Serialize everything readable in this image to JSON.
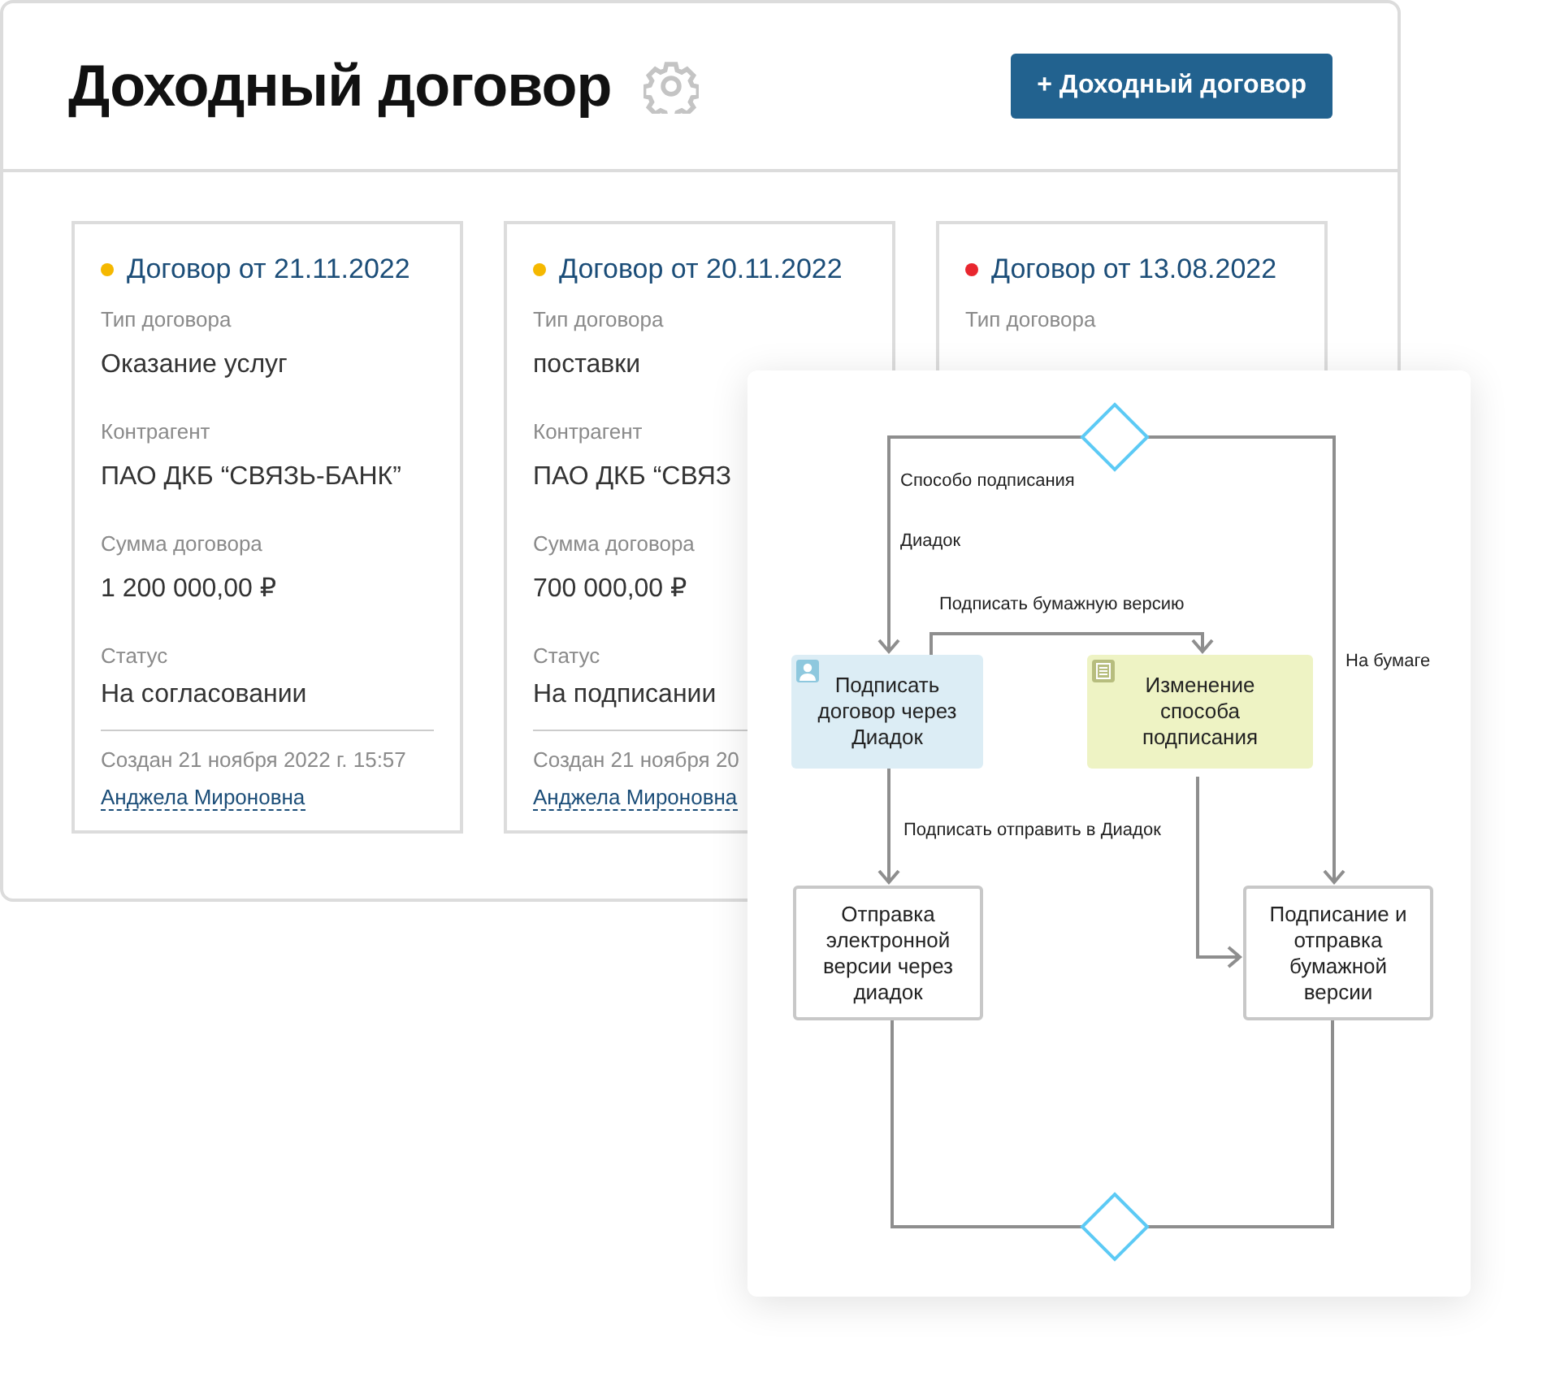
{
  "header": {
    "title": "Доходный договор",
    "add_button": "+ Доходный договор"
  },
  "contracts": [
    {
      "title": "Договор от 21.11.2022",
      "color": "#f5b800",
      "fields": [
        {
          "label": "Тип договора",
          "value": "Оказание услуг"
        },
        {
          "label": "Контрагент",
          "value": "ПАО ДКБ “СВЯЗЬ-БАНК”"
        },
        {
          "label": "Сумма договора",
          "value": "1 200 000,00 ₽"
        },
        {
          "label": "Статус",
          "value": "На согласовании"
        }
      ],
      "created": "Создан 21 ноября 2022 г. 15:57",
      "author": "Анджела Мироновна"
    },
    {
      "title": "Договор от 20.11.2022",
      "color": "#f5b800",
      "fields": [
        {
          "label": "Тип договора",
          "value": "поставки"
        },
        {
          "label": "Контрагент",
          "value": "ПАО ДКБ “СВЯЗ"
        },
        {
          "label": "Сумма договора",
          "value": "700 000,00 ₽"
        },
        {
          "label": "Статус",
          "value": "На подписании"
        }
      ],
      "created": "Создан 21 ноября 20",
      "author": "Анджела Мироновна"
    },
    {
      "title": "Договор от 13.08.2022",
      "color": "#e8262e",
      "fields": [
        {
          "label": "Тип договора"
        }
      ]
    }
  ],
  "diagram": {
    "nodes": [
      {
        "kind": "user_task",
        "text": "Подписать договор через Диадок",
        "color": "#dcedf5"
      },
      {
        "kind": "manual_task",
        "text": "Изменение способа подписания",
        "color": "#eef3c4"
      },
      {
        "kind": "plain",
        "text": "Отправка электронной версии через диадок"
      },
      {
        "kind": "plain",
        "text": "Подписание и отправка бумажной версии"
      }
    ],
    "edge_labels": [
      "Способо подписания",
      "Диадок",
      "Подписать бумажную версию",
      "На бумаге",
      "Подписать отправить в Диадок"
    ]
  }
}
